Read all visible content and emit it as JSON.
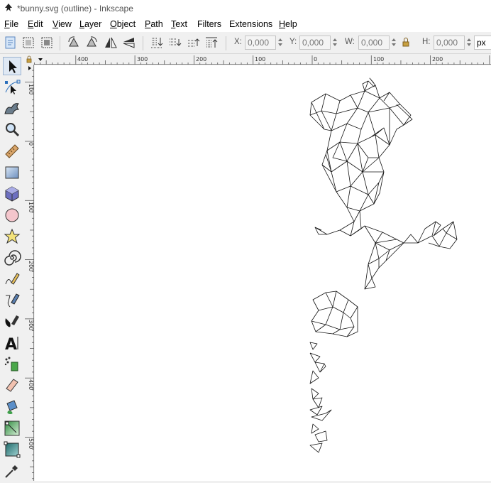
{
  "window": {
    "title": "*bunny.svg (outline) - Inkscape"
  },
  "menubar": {
    "items": [
      {
        "label": "File",
        "accel": "F",
        "rest": "ile"
      },
      {
        "label": "Edit",
        "accel": "E",
        "rest": "dit"
      },
      {
        "label": "View",
        "accel": "V",
        "rest": "iew"
      },
      {
        "label": "Layer",
        "accel": "L",
        "rest": "ayer"
      },
      {
        "label": "Object",
        "accel": "O",
        "rest": "bject"
      },
      {
        "label": "Path",
        "accel": "P",
        "rest": "ath"
      },
      {
        "label": "Text",
        "accel": "T",
        "rest": "ext"
      },
      {
        "label": "Filters",
        "accel": "",
        "rest": "Filters"
      },
      {
        "label": "Extensions",
        "accel": "",
        "rest": "Extensions"
      },
      {
        "label": "Help",
        "accel": "H",
        "rest": "elp"
      }
    ]
  },
  "toolbar": {
    "x": {
      "label": "X:",
      "value": "0,000"
    },
    "y": {
      "label": "Y:",
      "value": "0,000"
    },
    "w": {
      "label": "W:",
      "value": "0,000"
    },
    "h": {
      "label": "H:",
      "value": "0,000"
    },
    "unit": "px"
  },
  "rulers": {
    "horizontal_labels": [
      "400",
      "300",
      "200",
      "100",
      "0",
      "100",
      "200"
    ],
    "vertical_labels": [
      "100",
      "0",
      "100",
      "200",
      "300",
      "400",
      "500"
    ]
  },
  "toolbox": {
    "tools": [
      "selector-tool",
      "node-tool",
      "tweak-tool",
      "zoom-tool",
      "measure-tool",
      "rectangle-tool",
      "3d-box-tool",
      "ellipse-tool",
      "star-tool",
      "spiral-tool",
      "pencil-tool",
      "pen-tool",
      "calligraphy-tool",
      "text-tool",
      "spray-tool",
      "eraser-tool",
      "paint-bucket-tool",
      "gradient-tool",
      "mesh-tool",
      "dropper-tool"
    ],
    "active": "selector-tool"
  },
  "colors": {
    "accent": "#2a6ebb",
    "canvas": "#ffffff",
    "outline": "#000000"
  }
}
